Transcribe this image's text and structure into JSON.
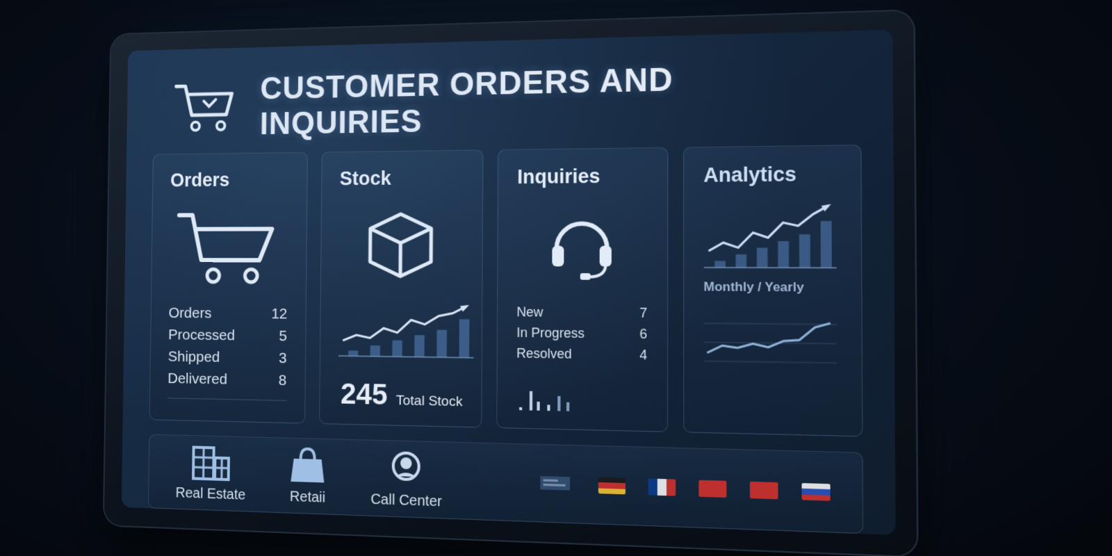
{
  "header": {
    "title": "CUSTOMER ORDERS AND INQUIRIES",
    "icon": "shopping-cart-icon"
  },
  "orders": {
    "title": "Orders",
    "icon": "shopping-cart-icon",
    "rows": [
      {
        "label": "Orders",
        "value": "12"
      },
      {
        "label": "Processed",
        "value": "5"
      },
      {
        "label": "Shipped",
        "value": "3"
      },
      {
        "label": "Delivered",
        "value": "8"
      }
    ]
  },
  "stock": {
    "title": "Stock",
    "icon": "box-icon",
    "total_value": "245",
    "total_label": "Total Stock",
    "chart_data": {
      "type": "bar",
      "bars": [
        1,
        2,
        3,
        4,
        5,
        7
      ],
      "trend": [
        2.2,
        3.0,
        2.6,
        4.0,
        3.4,
        5.2,
        4.6,
        5.8,
        6.2,
        7.2
      ]
    }
  },
  "inquiries": {
    "title": "Inquiries",
    "icon": "headset-icon",
    "rows": [
      {
        "label": "New",
        "value": "7"
      },
      {
        "label": "In Progress",
        "value": "6"
      },
      {
        "label": "Resolved",
        "value": "4"
      }
    ]
  },
  "analytics": {
    "title": "Analytics",
    "subtitle": "Monthly / Yearly",
    "chart_data": {
      "type": "bar",
      "bars": [
        1,
        2,
        3,
        4,
        5,
        7
      ],
      "trend": [
        2.0,
        3.0,
        2.4,
        4.2,
        3.6,
        5.4,
        5.0,
        6.4,
        7.4
      ]
    },
    "line_chart": [
      1.5,
      2.2,
      2.0,
      2.4,
      2.1,
      2.7,
      2.8,
      4.0,
      4.4
    ]
  },
  "footer": {
    "items": [
      {
        "label": "Real Estate",
        "icon": "buildings-icon"
      },
      {
        "label": "Retaii",
        "icon": "shopping-bag-icon"
      },
      {
        "label": "Call Center",
        "icon": "headset-icon"
      }
    ],
    "flags": [
      "#1a1a1a,#d0312d,#f1c232",
      "#0d3b8c,#f4f4f4,#d0312d",
      "#d0312d,#d0312d,#d0312d",
      "#d0312d,#d0312d,#d0312d",
      "#f4f4f4,#2a52be,#d0312d"
    ]
  }
}
